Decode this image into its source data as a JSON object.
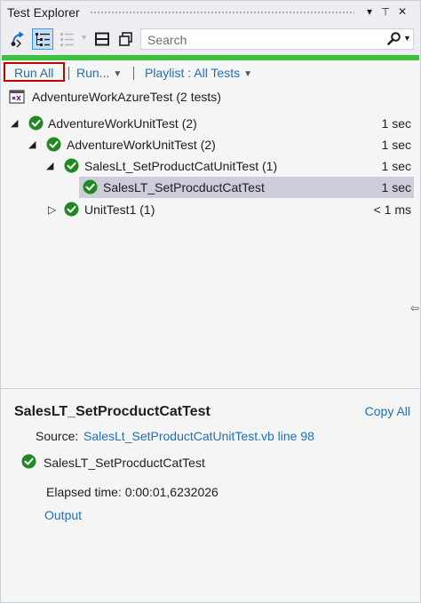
{
  "window": {
    "title": "Test Explorer",
    "dropdown_glyph": "▾",
    "pin_glyph": "⊥",
    "close_glyph": "✕"
  },
  "toolbar": {
    "icons": [
      "group-by-icon",
      "hierarchy-view-icon",
      "list-view-icon",
      "playlist-options-icon",
      "copy-icon"
    ],
    "search": {
      "placeholder": "Search",
      "value": ""
    }
  },
  "progress": {
    "percent": 100,
    "color": "#3dc23d"
  },
  "commands": {
    "run_all": "Run All",
    "run": "Run...",
    "playlist": "Playlist : All Tests"
  },
  "tree": {
    "solution": "AdventureWorkAzureTest (2 tests)",
    "nodes": [
      {
        "label": "AdventureWorkUnitTest (2)",
        "duration": "1 sec",
        "expanded": true,
        "status": "passed"
      },
      {
        "label": "AdventureWorkUnitTest (2)",
        "duration": "1 sec",
        "expanded": true,
        "status": "passed"
      },
      {
        "label": "SalesLt_SetProductCatUnitTest (1)",
        "duration": "1 sec",
        "expanded": true,
        "status": "passed"
      },
      {
        "label": "SalesLT_SetProcductCatTest",
        "duration": "1 sec",
        "selected": true,
        "status": "passed"
      },
      {
        "label": "UnitTest1 (1)",
        "duration": "< 1 ms",
        "expanded": false,
        "status": "passed"
      }
    ]
  },
  "details": {
    "title": "SalesLT_SetProcductCatTest",
    "copy_all": "Copy All",
    "source_label": "Source:",
    "source_link": "SalesLt_SetProductCatUnitTest.vb line 98",
    "test_name": "SalesLT_SetProcductCatTest",
    "elapsed": "Elapsed time: 0:00:01,6232026",
    "output": "Output"
  },
  "colors": {
    "pass": "#1f8a1f",
    "link": "#1e6fbf",
    "selection": "#cccedb",
    "highlight_box": "#c00000"
  }
}
